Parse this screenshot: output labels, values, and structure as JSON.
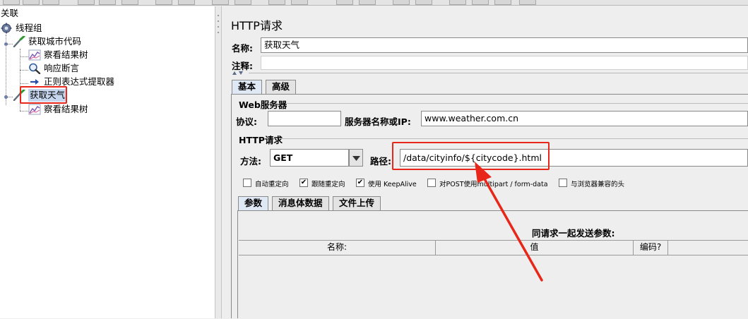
{
  "tree": {
    "root_label": "关联",
    "nodes": [
      {
        "label": "线程组",
        "icon": "gear-icon"
      },
      {
        "label": "获取城市代码",
        "icon": "pipette-icon"
      },
      {
        "label": "察看结果树",
        "icon": "chart-icon"
      },
      {
        "label": "响应断言",
        "icon": "magnifier-icon"
      },
      {
        "label": "正则表达式提取器",
        "icon": "arrow-icon"
      },
      {
        "label": "获取天气",
        "icon": "pipette-icon"
      },
      {
        "label": "察看结果树",
        "icon": "chart-icon"
      }
    ]
  },
  "panel": {
    "title": "HTTP请求",
    "name_label": "名称:",
    "name_value": "获取天气",
    "comment_label": "注释:",
    "comment_value": ""
  },
  "tabs": [
    "基本",
    "高级"
  ],
  "web_server": {
    "section_label": "Web服务器",
    "protocol_label": "协议:",
    "protocol_value": "",
    "server_label": "服务器名称或IP:",
    "server_value": "www.weather.com.cn"
  },
  "http_request": {
    "section_label": "HTTP请求",
    "method_label": "方法:",
    "method_value": "GET",
    "path_label": "路径:",
    "path_value": "/data/cityinfo/${citycode}.html"
  },
  "options": [
    {
      "label": "自动重定向",
      "checked": false
    },
    {
      "label": "跟随重定向",
      "checked": true
    },
    {
      "label": "使用 KeepAlive",
      "checked": true
    },
    {
      "label": "对POST使用multipart / form-data",
      "checked": false
    },
    {
      "label": "与浏览器兼容的头",
      "checked": false
    }
  ],
  "param_tabs": [
    "参数",
    "消息体数据",
    "文件上传"
  ],
  "params": {
    "caption": "同请求一起发送参数:",
    "columns": [
      "名称:",
      "值",
      "编码?"
    ]
  },
  "colors": {
    "highlight": "#e8261a",
    "active_tab": "#dfe8f5",
    "panel_bg": "#eeeeee"
  }
}
